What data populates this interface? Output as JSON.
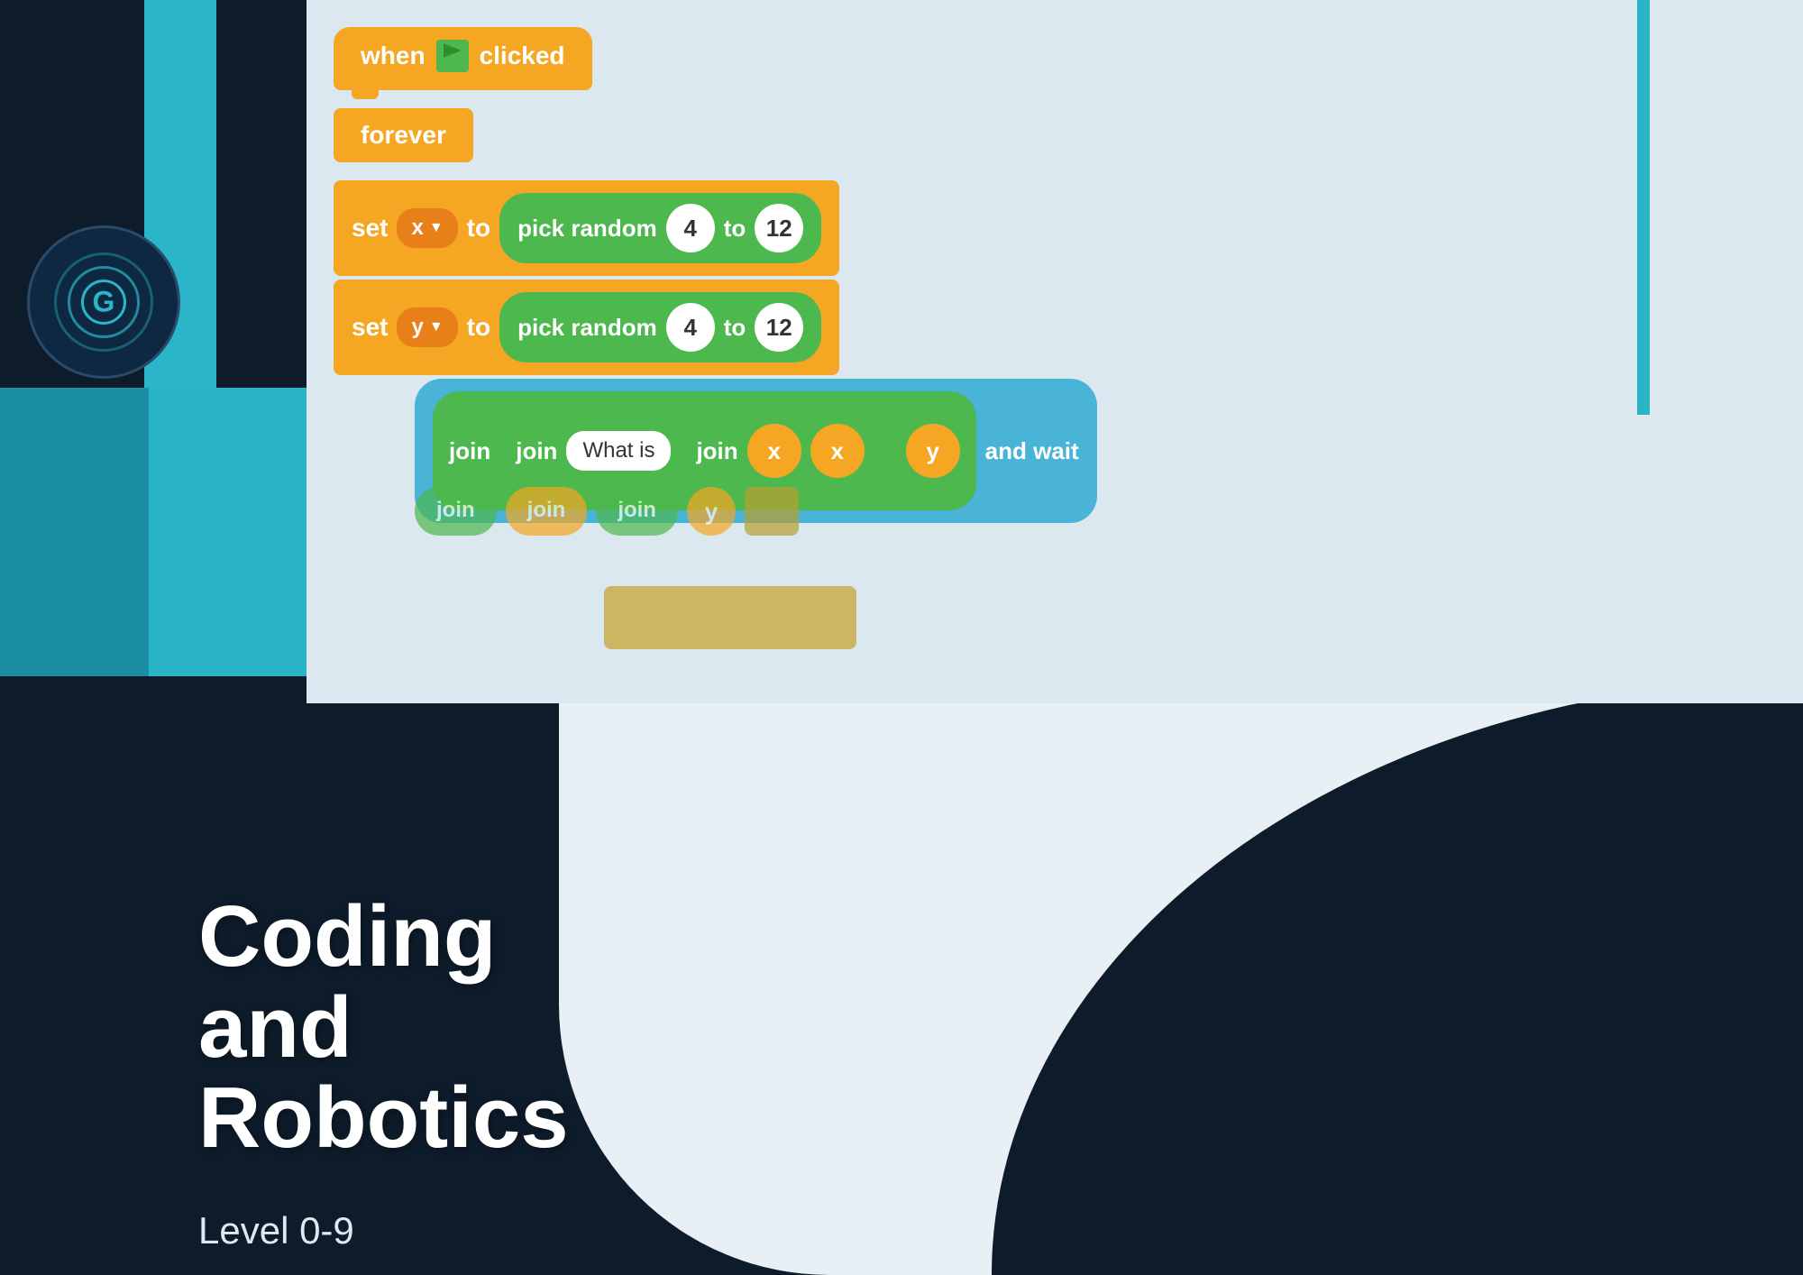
{
  "background": {
    "dark_color": "#0d1b2a",
    "teal_color": "#2bb5c8",
    "light_color": "#e8f0f5"
  },
  "logo": {
    "letter": "G",
    "aria_label": "Coding and Robotics Logo"
  },
  "title": {
    "main": "Coding and Robotics",
    "subtitle": "Level 0-9"
  },
  "scratch_blocks": {
    "row1": {
      "label_when": "when",
      "label_clicked": "clicked"
    },
    "row2": {
      "label": "forever"
    },
    "row3": {
      "set_label": "set",
      "var": "x",
      "to_label": "to",
      "pick_random_label": "pick random",
      "num1": "4",
      "to2_label": "to",
      "num2": "12"
    },
    "row4": {
      "set_label": "set",
      "var": "y",
      "to_label": "to",
      "pick_random_label": "pick random",
      "num1": "4",
      "to2_label": "to",
      "num2": "12"
    },
    "row5": {
      "join1_label": "join",
      "join2_label": "join",
      "what_is": "What is",
      "join3_label": "join",
      "x_label": "x",
      "x2_label": "x",
      "y_label": "y",
      "and_wait": "and wait"
    }
  },
  "divider": "—"
}
